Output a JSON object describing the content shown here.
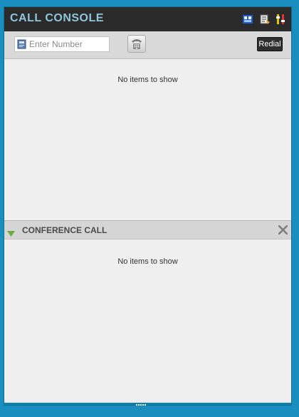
{
  "window": {
    "title": "CALL CONSOLE",
    "icons": [
      "presence-icon",
      "contacts-icon",
      "settings-icon"
    ]
  },
  "toolbar": {
    "number_input": {
      "placeholder": "Enter Number",
      "value": ""
    },
    "dial_button_icon": "phone-keypad-icon",
    "redial_label": "Redial"
  },
  "call_list": {
    "empty_text": "No items to show"
  },
  "conference": {
    "title": "CONFERENCE CALL",
    "empty_text": "No items to show"
  },
  "colors": {
    "title_bar": "#2b2b2b",
    "title_text": "#8fc6dc",
    "border": "#1a8fbf",
    "expand_arrow": "#6bab3f"
  }
}
